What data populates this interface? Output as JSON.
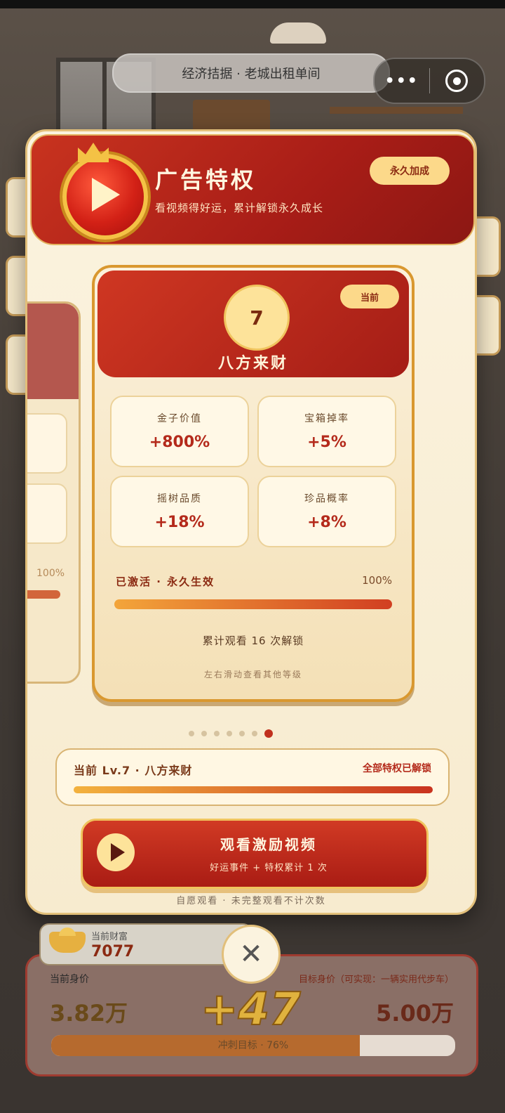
{
  "top_bar": {
    "location_title": "经济拮据 · 老城出租单间",
    "menu_icon": "more-dots-icon",
    "close_icon": "target-icon"
  },
  "modal": {
    "header": {
      "title": "广告特权",
      "subtitle": "看视频得好运，累计解锁永久成长",
      "badge": "永久加成"
    },
    "level_card": {
      "level": "7",
      "name": "八方来财",
      "current_tag": "当前",
      "stats": [
        {
          "label": "金子价值",
          "value": "+800%"
        },
        {
          "label": "宝箱掉率",
          "value": "+5%"
        },
        {
          "label": "摇树品质",
          "value": "+18%"
        },
        {
          "label": "珍品概率",
          "value": "+8%"
        }
      ],
      "activation_label": "已激活 · 永久生效",
      "activation_percent_text": "100%",
      "activation_progress": 1.0,
      "watch_count_text": "累计观看 16 次解锁",
      "swipe_hint": "左右滑动查看其他等级"
    },
    "peek_card": {
      "percent_text": "100%"
    },
    "pager": {
      "count": 7,
      "active_index": 6
    },
    "progress_panel": {
      "left_text": "当前 Lv.7 · 八方来财",
      "right_text": "全部特权已解锁",
      "progress": 1.0
    },
    "cta": {
      "title": "观看激励视频",
      "subtitle": "好运事件 + 特权累计 1 次"
    },
    "note": "自愿观看 · 未完整观看不计次数"
  },
  "hud": {
    "wealth_label": "当前财富",
    "wealth_value": "7077",
    "current_worth_label": "当前身价",
    "current_worth_value": "3.82万",
    "target_worth_label": "目标身价（可实现：一辆实用代步车）",
    "target_worth_value": "5.00万",
    "bar_label": "冲刺目标 · 76%",
    "bar_progress": 0.764,
    "floating_number": "+47"
  },
  "colors": {
    "accent_red": "#b42a1b",
    "gold": "#f0c45e",
    "cream": "#fbf3df"
  }
}
